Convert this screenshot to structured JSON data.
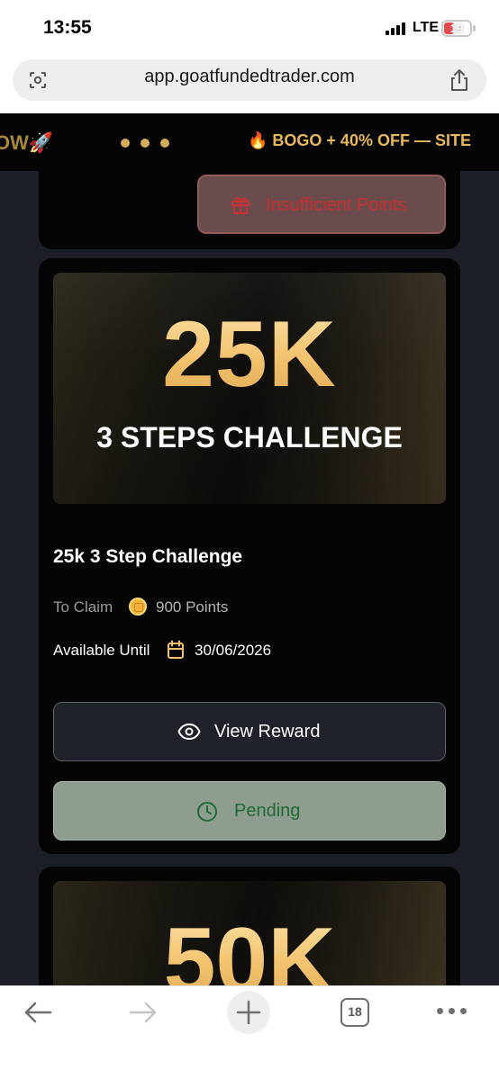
{
  "status_bar": {
    "time": "13:55",
    "network": "LTE",
    "battery": "19"
  },
  "browser": {
    "url": "app.goatfundedtrader.com",
    "tab_count": "18"
  },
  "banner": {
    "left_fragment": "OW🚀",
    "promo": "🔥 BOGO + 40% OFF — SITE"
  },
  "previous_card": {
    "button_label": "Insufficient Points"
  },
  "reward_card": {
    "hero_amount": "25K",
    "hero_subtitle": "3 STEPS CHALLENGE",
    "title": "25k 3 Step Challenge",
    "claim_label": "To Claim",
    "claim_value": "900 Points",
    "available_label": "Available Until",
    "available_value": "30/06/2026",
    "view_button": "View Reward",
    "status_button": "Pending"
  },
  "next_card": {
    "hero_amount": "50K"
  },
  "colors": {
    "gold": "#f2c06b",
    "pending_bg": "#8e9d8f",
    "pending_text": "#1e6b35",
    "insufficient_text": "#c9302f"
  }
}
